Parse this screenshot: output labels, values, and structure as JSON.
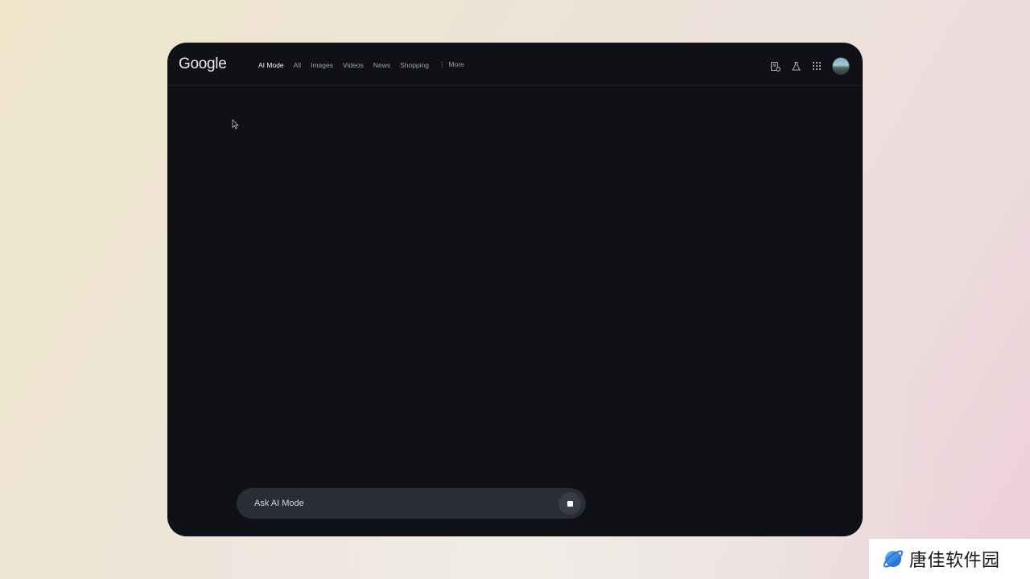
{
  "header": {
    "logo": "Google",
    "tabs": [
      {
        "label": "AI Mode",
        "active": true
      },
      {
        "label": "All"
      },
      {
        "label": "Images"
      },
      {
        "label": "Videos"
      },
      {
        "label": "News"
      },
      {
        "label": "Shopping"
      },
      {
        "label": "More"
      }
    ],
    "icons": [
      "history-icon",
      "labs-flask-icon",
      "apps-grid-icon",
      "account-avatar"
    ]
  },
  "main": {
    "faded_text": ""
  },
  "ask_bar": {
    "placeholder": "Ask AI Mode",
    "button_icon": "stop-icon"
  },
  "watermark": {
    "text": "唐佳软件园"
  },
  "colors": {
    "window_bg": "#0f1117",
    "ask_bar_bg": "#2a2c36",
    "accent_text": "#f2f3f5"
  }
}
